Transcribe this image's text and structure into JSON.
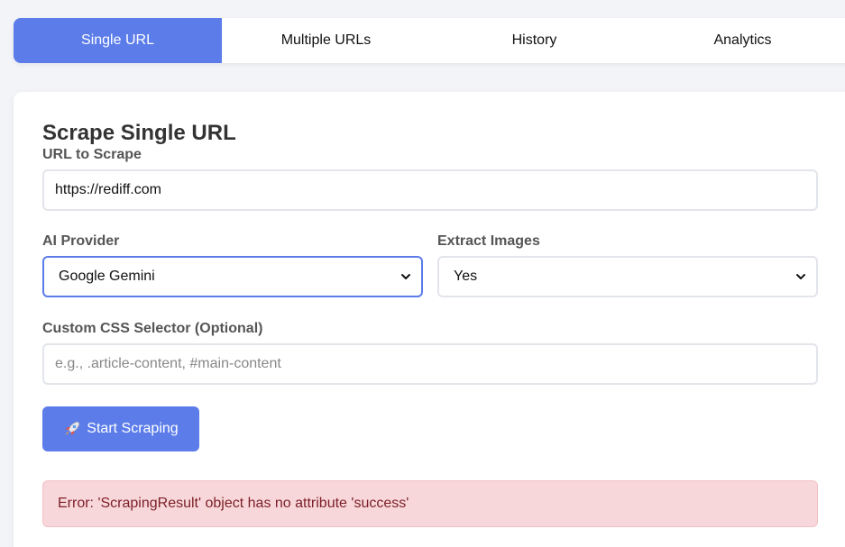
{
  "tabs": [
    {
      "label": "Single URL",
      "active": true
    },
    {
      "label": "Multiple URLs",
      "active": false
    },
    {
      "label": "History",
      "active": false
    },
    {
      "label": "Analytics",
      "active": false
    }
  ],
  "form": {
    "title": "Scrape Single URL",
    "url_label": "URL to Scrape",
    "url_value": "https://rediff.com",
    "provider_label": "AI Provider",
    "provider_value": "Google Gemini",
    "images_label": "Extract Images",
    "images_value": "Yes",
    "selector_label": "Custom CSS Selector (Optional)",
    "selector_placeholder": "e.g., .article-content, #main-content",
    "selector_value": "",
    "submit_label": "Start Scraping",
    "submit_icon": "rocket-icon"
  },
  "error": {
    "message": "Error: 'ScrapingResult' object has no attribute 'success'"
  },
  "colors": {
    "accent": "#5b7ce9",
    "error_bg": "#f8d7da",
    "error_text": "#7b1f27",
    "page_bg": "#f3f4f8"
  }
}
